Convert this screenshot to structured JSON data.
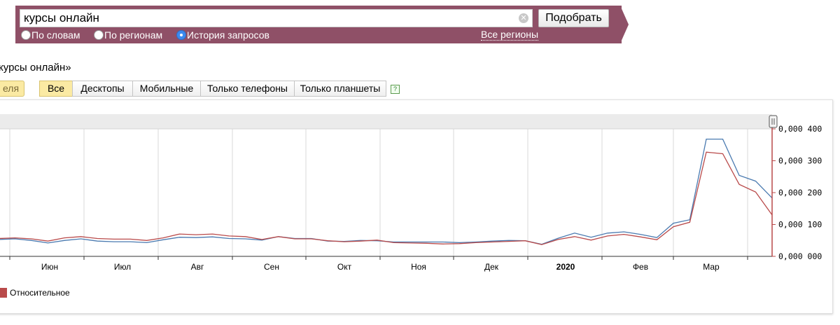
{
  "search": {
    "query": "курсы онлайн",
    "button_label": "Подобрать"
  },
  "radios": [
    {
      "label": "По словам",
      "selected": false
    },
    {
      "label": "По регионам",
      "selected": false
    },
    {
      "label": "История запросов",
      "selected": true
    }
  ],
  "regions_link": "Все регионы",
  "query_title": "курсы онлайн»",
  "period_tab": "еля",
  "device_tabs": [
    "Все",
    "Десктопы",
    "Мобильные",
    "Только телефоны",
    "Только планшеты"
  ],
  "help_icon": "?",
  "colors": {
    "banner": "#8f5067",
    "series_blue": "#4a7ab0",
    "series_red": "#b94a4a"
  },
  "chart_data": {
    "type": "line",
    "months": [
      "Июн",
      "Июл",
      "Авг",
      "Сен",
      "Окт",
      "Ноя",
      "Дек",
      "2020",
      "Фев",
      "Мар"
    ],
    "y_ticks": [
      "0,000 000",
      "0,000 100",
      "0,000 200",
      "0,000 300",
      "0,000 400"
    ],
    "ylim": [
      0,
      0.0004
    ],
    "grid": true,
    "legend": [
      "Относительное"
    ],
    "series": [
      {
        "color": "#4a7ab0",
        "values": [
          5.3e-05,
          5.5e-05,
          5e-05,
          4.2e-05,
          5e-05,
          5.5e-05,
          4.8e-05,
          4.6e-05,
          4.6e-05,
          4.3e-05,
          5.2e-05,
          6e-05,
          5.9e-05,
          6.1e-05,
          5.6e-05,
          5.5e-05,
          5.1e-05,
          6.2e-05,
          5.6e-05,
          5.6e-05,
          4.8e-05,
          4.7e-05,
          5e-05,
          4.9e-05,
          4.5e-05,
          4.5e-05,
          4.5e-05,
          4.5e-05,
          4.3e-05,
          4.5e-05,
          4.8e-05,
          5e-05,
          4.9e-05,
          3.8e-05,
          5.7e-05,
          7.3e-05,
          6e-05,
          7.3e-05,
          7.7e-05,
          6.9e-05,
          5.9e-05,
          0.000104,
          0.000115,
          0.000368,
          0.000368,
          0.000254,
          0.000236,
          0.000183
        ]
      },
      {
        "color": "#b94a4a",
        "values": [
          5.6e-05,
          5.8e-05,
          5.5e-05,
          4.8e-05,
          5.8e-05,
          6.2e-05,
          5.6e-05,
          5.4e-05,
          5.4e-05,
          5e-05,
          5.8e-05,
          7e-05,
          6.8e-05,
          7e-05,
          6.4e-05,
          6.2e-05,
          5.3e-05,
          6.2e-05,
          5.5e-05,
          5.5e-05,
          4.9e-05,
          4.6e-05,
          4.8e-05,
          5.1e-05,
          4.3e-05,
          4.2e-05,
          4.1e-05,
          3.9e-05,
          4e-05,
          4.3e-05,
          4.5e-05,
          4.7e-05,
          4.9e-05,
          3.7e-05,
          5.3e-05,
          6.2e-05,
          5.1e-05,
          6.4e-05,
          6.9e-05,
          6.1e-05,
          5.2e-05,
          9.3e-05,
          0.000107,
          0.000327,
          0.000322,
          0.000226,
          0.000202,
          0.00013
        ]
      }
    ]
  }
}
